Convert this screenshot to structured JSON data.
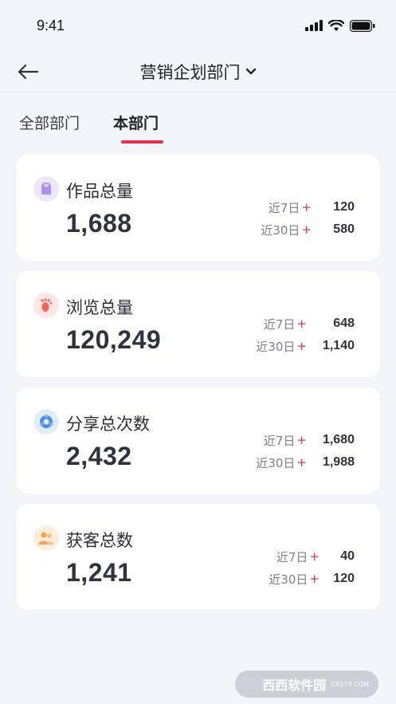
{
  "status": {
    "time": "9:41"
  },
  "header": {
    "title": "营销企划部门"
  },
  "tabs": [
    {
      "label": "全部部门",
      "active": false
    },
    {
      "label": "本部门",
      "active": true
    }
  ],
  "cards": [
    {
      "label": "作品总量",
      "total": "1,688",
      "icon": "works-icon",
      "icon_color": "#8a6fe0",
      "icon_bg": "#ece7fb",
      "stats": [
        {
          "label": "近7日",
          "value": "120"
        },
        {
          "label": "近30日",
          "value": "580"
        }
      ]
    },
    {
      "label": "浏览总量",
      "total": "120,249",
      "icon": "footprint-icon",
      "icon_color": "#f0665d",
      "icon_bg": "#fde6e4",
      "stats": [
        {
          "label": "近7日",
          "value": "648"
        },
        {
          "label": "近30日",
          "value": "1,140"
        }
      ]
    },
    {
      "label": "分享总次数",
      "total": "2,432",
      "icon": "share-icon",
      "icon_color": "#4b8ee8",
      "icon_bg": "#e2edfc",
      "stats": [
        {
          "label": "近7日",
          "value": "1,680"
        },
        {
          "label": "近30日",
          "value": "1,988"
        }
      ]
    },
    {
      "label": "获客总数",
      "total": "1,241",
      "icon": "customers-icon",
      "icon_color": "#f3a44b",
      "icon_bg": "#fdeedd",
      "stats": [
        {
          "label": "近7日",
          "value": "40"
        },
        {
          "label": "近30日",
          "value": "120"
        }
      ]
    }
  ],
  "stat_plus": "+",
  "watermark": {
    "text": "西西软件园",
    "sub": "CR173.COM"
  }
}
